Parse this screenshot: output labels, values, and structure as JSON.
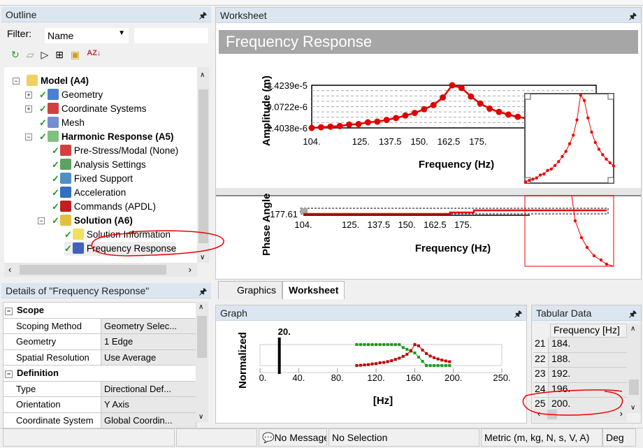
{
  "outline": {
    "title": "Outline",
    "filter_label": "Filter:",
    "filter_value": "Name",
    "tree": [
      {
        "label": "Model (A4)",
        "bold": true
      },
      {
        "label": "Geometry"
      },
      {
        "label": "Coordinate Systems"
      },
      {
        "label": "Mesh"
      },
      {
        "label": "Harmonic Response (A5)",
        "bold": true
      },
      {
        "label": "Pre-Stress/Modal (None)"
      },
      {
        "label": "Analysis Settings"
      },
      {
        "label": "Fixed Support"
      },
      {
        "label": "Acceleration"
      },
      {
        "label": "Commands (APDL)"
      },
      {
        "label": "Solution (A6)",
        "bold": true
      },
      {
        "label": "Solution Information"
      },
      {
        "label": "Frequency Response"
      }
    ]
  },
  "worksheet": {
    "title": "Worksheet",
    "heading": "Frequency Response"
  },
  "tabs": [
    {
      "label": "Graphics"
    },
    {
      "label": "Worksheet",
      "active": true
    }
  ],
  "details": {
    "title": "Details of \"Frequency Response\"",
    "rows": [
      {
        "category": "Scope"
      },
      {
        "name": "Scoping Method",
        "value": "Geometry Selec..."
      },
      {
        "name": "Geometry",
        "value": "1 Edge"
      },
      {
        "name": "Spatial Resolution",
        "value": "Use Average"
      },
      {
        "category": "Definition"
      },
      {
        "name": "Type",
        "value": "Directional Def..."
      },
      {
        "name": "Orientation",
        "value": "Y Axis"
      },
      {
        "name": "Coordinate System",
        "value": "Global Coordin..."
      }
    ]
  },
  "graph": {
    "title": "Graph",
    "ylabel": "Normalized",
    "xlabel": "[Hz]",
    "marker_label": "20.",
    "xticks": [
      "0.",
      "40.",
      "80.",
      "120.",
      "160.",
      "200.",
      "250."
    ]
  },
  "tabular": {
    "title": "Tabular Data",
    "column": "Frequency [Hz]",
    "rows": [
      {
        "n": "21",
        "f": "184."
      },
      {
        "n": "22",
        "f": "188."
      },
      {
        "n": "23",
        "f": "192."
      },
      {
        "n": "24",
        "f": "196."
      },
      {
        "n": "25",
        "f": "200."
      }
    ]
  },
  "status": {
    "messages": "No Messages",
    "selection": "No Selection",
    "units": "Metric (m, kg, N, s, V, A)",
    "angle": "Deg"
  },
  "chart_data": [
    {
      "type": "line",
      "title": "Amplitude",
      "xlabel": "Frequency (Hz)",
      "ylabel": "Amplitude (m)",
      "yscale": "log",
      "xticks": [
        "104.",
        "125.",
        "137.5",
        "150.",
        "162.5",
        "175."
      ],
      "yticks": [
        "3.4239e-5",
        "9.0722e-6",
        "2.4038e-6"
      ],
      "ylim": [
        2.4038e-06,
        3.4239e-05
      ],
      "xlim": [
        104,
        200
      ],
      "x": [
        104,
        108,
        112,
        116,
        120,
        124,
        128,
        132,
        136,
        140,
        144,
        148,
        152,
        156,
        160,
        164,
        168,
        172,
        176,
        180,
        184,
        188,
        192,
        196,
        200
      ],
      "values": [
        2.4e-06,
        2.5e-06,
        2.6e-06,
        2.7e-06,
        2.95e-06,
        3.05e-06,
        3.4e-06,
        3.55e-06,
        3.95e-06,
        4.45e-06,
        5.2e-06,
        6.1e-06,
        7.7e-06,
        1e-05,
        1.6e-05,
        3.42e-05,
        2.9e-05,
        1.7e-05,
        1.1e-05,
        8e-06,
        6.5e-06,
        5.5e-06,
        4.8e-06,
        4.3e-06,
        3.9e-06
      ],
      "color": "#e00000"
    },
    {
      "type": "line",
      "title": "Phase Angle",
      "xlabel": "Frequency (Hz)",
      "ylabel": "Phase Angle",
      "yticks": [
        "177.61"
      ],
      "xticks": [
        "104.",
        "125.",
        "137.5",
        "150.",
        "162.5",
        "175."
      ]
    }
  ]
}
